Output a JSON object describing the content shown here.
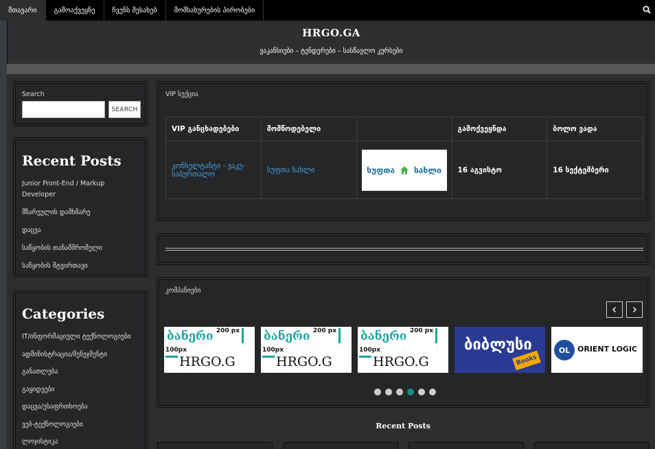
{
  "nav": {
    "items": [
      "მთავარი",
      "გამოაქვეყნე",
      "ჩვენს შესახებ",
      "მომსახურების პირობები"
    ],
    "search_icon": "search-icon"
  },
  "header": {
    "title": "HRGO.GA",
    "tagline": "ვაკანსიები – ტენდერები – სასწავლო კურსები"
  },
  "search_widget": {
    "label": "Search",
    "input_value": "",
    "button_label": "SEARCH"
  },
  "recent_posts_widget": {
    "title": "Recent Posts",
    "items": [
      "Junior Front-End / Markup Developer",
      "მზარეულის დამხმარე",
      "დაცვა",
      "საწყობის თანამშრომელი",
      "საწყობის მტვირთავი"
    ]
  },
  "categories_widget": {
    "title": "Categories",
    "items": [
      "IT/ინფორმაციული ტექნოლოგიები",
      "ადმინისტრაცია/მენეჯმენტი",
      "განათლება",
      "გაყიდვები",
      "დაცვა/უსაფრთხოება",
      "ვებ-ტექნოლოგიები",
      "ლოჯისტიკა"
    ]
  },
  "vip": {
    "label": "VIP სექცია",
    "headers": [
      "VIP განცხადებები",
      "მომწოდებელი",
      "",
      "გამოქვეყნდა",
      "ბოლო ვადა"
    ],
    "rows": [
      {
        "title": "კონსულტანტი - ვაკუ-საბურთალო",
        "provider": "სუფთა სახლი",
        "logo_text_left": "სუფთა",
        "logo_text_right": "სახლი",
        "published": "16 აგვისტო",
        "deadline": "16 სექტემბერი"
      }
    ]
  },
  "companies": {
    "label": "კომპანიები",
    "banner": {
      "title": "ბანერი",
      "width_label": "200 px",
      "height_label": "100px",
      "site": "HRGO.G"
    },
    "logo_bibliusi": "ბიბლუსი",
    "logo_bibliusi_sub": "Books",
    "logo_orient": "ORIENT LOGIC",
    "logo_orient_mark": "OL",
    "dots_count": 6,
    "active_dot": 4
  },
  "bottom": {
    "recent_posts_heading": "Recent Posts"
  },
  "colors": {
    "link": "#4a9fd8",
    "accent": "#1e8a7c",
    "banner_teal": "#1aa3a3"
  }
}
